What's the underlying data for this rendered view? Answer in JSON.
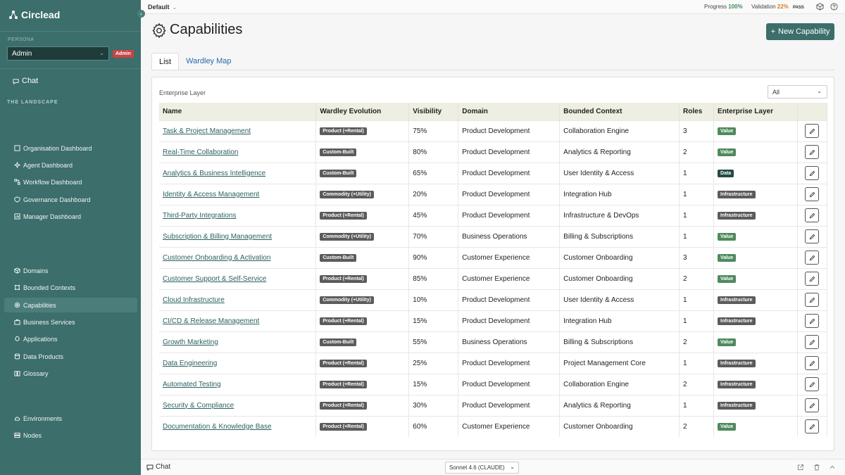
{
  "brand": "Circlead",
  "workspace": {
    "label": "Persona",
    "selected": "Admin",
    "badge": "Admin"
  },
  "chat_nav": "Chat",
  "section_title": "THE LANDSCAPE",
  "nav": {
    "dashboards": [
      "Organisation Dashboard",
      "Agent Dashboard",
      "Workflow Dashboard",
      "Governance Dashboard",
      "Manager Dashboard"
    ],
    "model": [
      "Domains",
      "Bounded Contexts",
      "Capabilities",
      "Business Services",
      "Applications",
      "Data Products",
      "Glossary"
    ],
    "infra": [
      "Environments",
      "Nodes"
    ]
  },
  "topbar": {
    "env": "Default",
    "progress_label": "Progress",
    "progress_value": "100%",
    "validation_label": "Validation",
    "validation_value": "22%",
    "validation_status": "PASS"
  },
  "page": {
    "title": "Capabilities",
    "new_button": "New Capability"
  },
  "tabs": [
    "List",
    "Wardley Map"
  ],
  "filter": {
    "label": "Enterprise Layer",
    "selected": "All"
  },
  "table": {
    "headers": [
      "Name",
      "Wardley Evolution",
      "Visibility",
      "Domain",
      "Bounded Context",
      "Roles",
      "Enterprise Layer",
      ""
    ],
    "rows": [
      {
        "name": "Task & Project Management",
        "evolution": "Product (+Rental)",
        "visibility": "75%",
        "domain": "Product Development",
        "context": "Collaboration Engine",
        "roles": "3",
        "layer": "Value"
      },
      {
        "name": "Real-Time Collaboration",
        "evolution": "Custom-Built",
        "visibility": "80%",
        "domain": "Product Development",
        "context": "Analytics & Reporting",
        "roles": "2",
        "layer": "Value"
      },
      {
        "name": "Analytics & Business Intelligence",
        "evolution": "Custom-Built",
        "visibility": "65%",
        "domain": "Product Development",
        "context": "User Identity & Access",
        "roles": "1",
        "layer": "Data"
      },
      {
        "name": "Identity & Access Management",
        "evolution": "Commodity (+Utility)",
        "visibility": "20%",
        "domain": "Product Development",
        "context": "Integration Hub",
        "roles": "1",
        "layer": "Infrastructure"
      },
      {
        "name": "Third-Party Integrations",
        "evolution": "Product (+Rental)",
        "visibility": "45%",
        "domain": "Product Development",
        "context": "Infrastructure & DevOps",
        "roles": "1",
        "layer": "Infrastructure"
      },
      {
        "name": "Subscription & Billing Management",
        "evolution": "Commodity (+Utility)",
        "visibility": "70%",
        "domain": "Business Operations",
        "context": "Billing & Subscriptions",
        "roles": "1",
        "layer": "Value"
      },
      {
        "name": "Customer Onboarding & Activation",
        "evolution": "Custom-Built",
        "visibility": "90%",
        "domain": "Customer Experience",
        "context": "Customer Onboarding",
        "roles": "3",
        "layer": "Value"
      },
      {
        "name": "Customer Support & Self-Service",
        "evolution": "Product (+Rental)",
        "visibility": "85%",
        "domain": "Customer Experience",
        "context": "Customer Onboarding",
        "roles": "2",
        "layer": "Value"
      },
      {
        "name": "Cloud Infrastructure",
        "evolution": "Commodity (+Utility)",
        "visibility": "10%",
        "domain": "Product Development",
        "context": "User Identity & Access",
        "roles": "1",
        "layer": "Infrastructure"
      },
      {
        "name": "CI/CD & Release Management",
        "evolution": "Product (+Rental)",
        "visibility": "15%",
        "domain": "Product Development",
        "context": "Integration Hub",
        "roles": "1",
        "layer": "Infrastructure"
      },
      {
        "name": "Growth Marketing",
        "evolution": "Custom-Built",
        "visibility": "55%",
        "domain": "Business Operations",
        "context": "Billing & Subscriptions",
        "roles": "2",
        "layer": "Value"
      },
      {
        "name": "Data Engineering",
        "evolution": "Product (+Rental)",
        "visibility": "25%",
        "domain": "Product Development",
        "context": "Project Management Core",
        "roles": "1",
        "layer": "Infrastructure"
      },
      {
        "name": "Automated Testing",
        "evolution": "Product (+Rental)",
        "visibility": "15%",
        "domain": "Product Development",
        "context": "Collaboration Engine",
        "roles": "2",
        "layer": "Infrastructure"
      },
      {
        "name": "Security & Compliance",
        "evolution": "Product (+Rental)",
        "visibility": "30%",
        "domain": "Product Development",
        "context": "Analytics & Reporting",
        "roles": "1",
        "layer": "Infrastructure"
      },
      {
        "name": "Documentation & Knowledge Base",
        "evolution": "Product (+Rental)",
        "visibility": "60%",
        "domain": "Customer Experience",
        "context": "Customer Onboarding",
        "roles": "2",
        "layer": "Value"
      }
    ]
  },
  "bottombar": {
    "chat": "Chat",
    "model": "Sonnet 4.6 (CLAUDE)"
  },
  "colors": {
    "sidebar": "#3c6e6b",
    "accent": "#3c6e6b",
    "value": "#4e8a5e",
    "data": "#244a43",
    "infrastructure": "#5b5b5b",
    "admin_badge": "#c64545"
  }
}
